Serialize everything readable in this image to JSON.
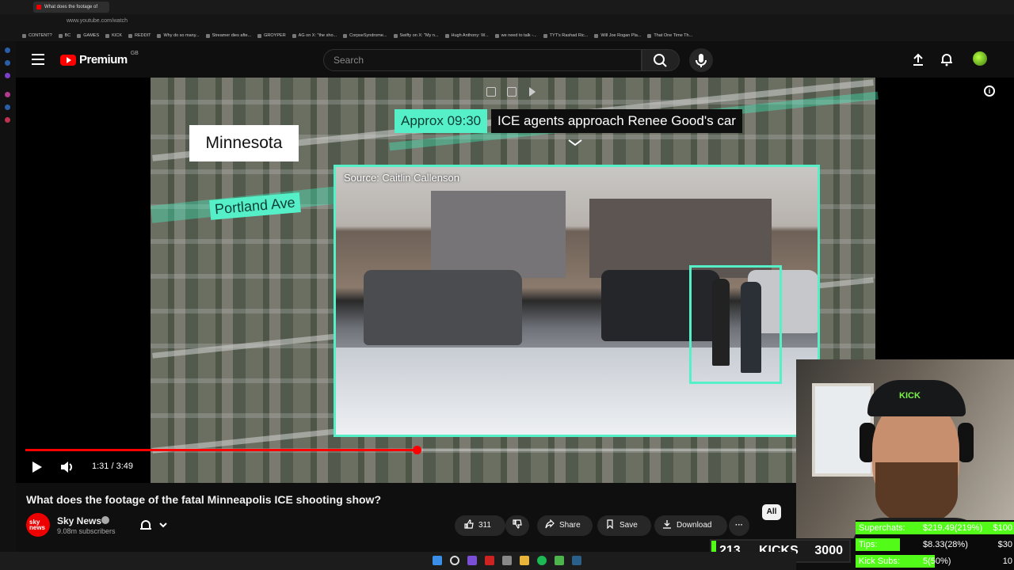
{
  "browser": {
    "tab_title": "What does the footage of",
    "url": "www.youtube.com/watch",
    "bookmarks": [
      "CONTENT?",
      "BC",
      "GAMES",
      "KICK",
      "REDDIT",
      "Why do so many...",
      "Streamer dies afte...",
      "GROYPER",
      "AG on X: \"the sho...",
      "CorpseSyndrome...",
      "Swifty on X: \"My n...",
      "Hugh Anthony: W...",
      "we need to talk -...",
      "TYT's Rashad Ric...",
      "Will Joe Rogan Pla...",
      "That One Time Th..."
    ]
  },
  "header": {
    "logo_text": "Premium",
    "region": "GB",
    "search_placeholder": "Search"
  },
  "player": {
    "map_label": "Minnesota",
    "street_label": "Portland Ave",
    "time_tag": "Approx 09:30",
    "caption": "ICE agents approach Renee Good's car",
    "source": "Source: Caitlin Callenson",
    "timecode": "1:31 / 3:49",
    "progress": 0.4
  },
  "video": {
    "title": "What does the footage of the fatal Minneapolis ICE shooting show?",
    "channel": "Sky News",
    "channel_avatar": "sky news",
    "subscribers": "9.08m subscribers",
    "likes": "311",
    "share": "Share",
    "save": "Save",
    "download": "Download",
    "chip_all": "All"
  },
  "webcam": {
    "hat_logo": "KICK"
  },
  "stream_overlay": {
    "kicks_count": "213",
    "kicks_label": "KICKS",
    "kicks_goal": "3000",
    "goals": [
      {
        "label": "Superchats:",
        "value": "$219.49(219%)",
        "target": "$100",
        "fill": 1.0
      },
      {
        "label": "Tips:",
        "value": "$8.33(28%)",
        "target": "$30",
        "fill": 0.28
      },
      {
        "label": "Kick Subs:",
        "value": "5(50%)",
        "target": "10",
        "fill": 0.5
      }
    ]
  }
}
